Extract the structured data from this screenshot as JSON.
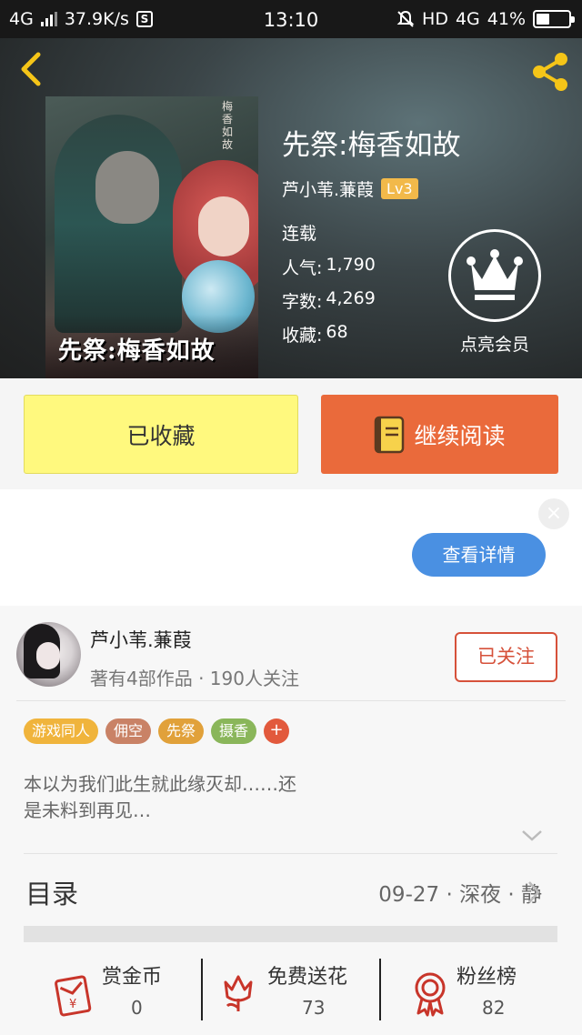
{
  "status_bar": {
    "network": "4G",
    "speed": "37.9K/s",
    "s_badge": "S",
    "time": "13:10",
    "hd": "HD",
    "net2": "4G",
    "battery_text": "41%",
    "battery_level": 0.41
  },
  "book": {
    "title": "先祭:梅香如故",
    "cover_title": "先祭:梅香如故",
    "cover_vertical": "梅香如故",
    "author": "芦小苇.蒹葭",
    "level": "Lv3",
    "status": "连载",
    "stats": [
      {
        "label": "人气:",
        "value": "1,790"
      },
      {
        "label": "字数:",
        "value": "4,269"
      },
      {
        "label": "收藏:",
        "value": "68"
      }
    ],
    "vip_label": "点亮会员"
  },
  "actions": {
    "favorited_label": "已收藏",
    "continue_label": "继续阅读"
  },
  "ad": {
    "close": "×",
    "detail_label": "查看详情"
  },
  "author_panel": {
    "name": "芦小苇.蒹葭",
    "subtitle": "著有4部作品 · 190人关注",
    "follow_label": "已关注"
  },
  "tags": [
    {
      "label": "游戏同人",
      "color": "#f0b43c"
    },
    {
      "label": "佣空",
      "color": "#c98266"
    },
    {
      "label": "先祭",
      "color": "#e1a13a"
    },
    {
      "label": "摄香",
      "color": "#8ab65a"
    }
  ],
  "tag_more": "+",
  "synopsis": "本以为我们此生就此缘灭却……还是未料到再见…",
  "toc": {
    "label": "目录",
    "latest": "09-27 · 深夜 · 静"
  },
  "bottom": [
    {
      "label": "赏金币",
      "count": "0",
      "icon": "red-envelope-icon"
    },
    {
      "label": "免费送花",
      "count": "73",
      "icon": "flower-icon"
    },
    {
      "label": "粉丝榜",
      "count": "82",
      "icon": "medal-icon"
    }
  ],
  "colors": {
    "accent_orange": "#ea6a3b",
    "fav_yellow": "#fff97e",
    "detail_blue": "#4a90e2",
    "follow_red": "#d6513a",
    "icon_gold": "#f5c518"
  }
}
